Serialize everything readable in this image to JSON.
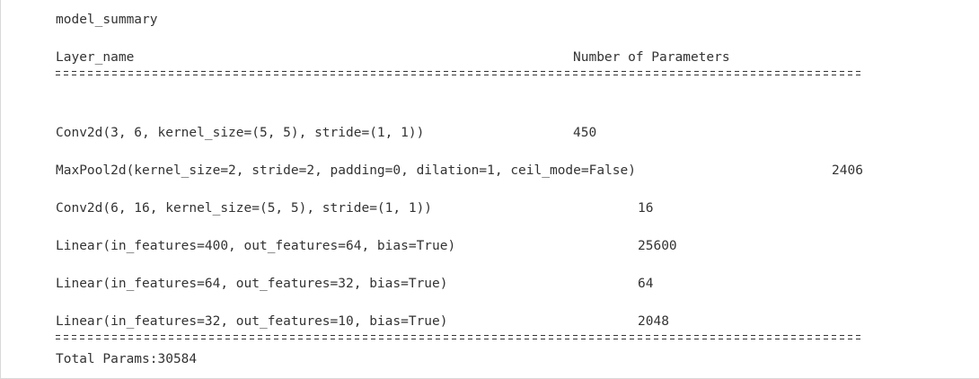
{
  "title": "model_summary",
  "header": {
    "layer_col": "Layer_name",
    "params_col": "Number of Parameters"
  },
  "layers": [
    {
      "name": "Conv2d(3, 6, kernel_size=(5, 5), stride=(1, 1))",
      "params": "450"
    },
    {
      "name": "MaxPool2d(kernel_size=2, stride=2, padding=0, dilation=1, ceil_mode=False)",
      "params": "2406"
    },
    {
      "name": "Conv2d(6, 16, kernel_size=(5, 5), stride=(1, 1))",
      "params": "16"
    },
    {
      "name": "Linear(in_features=400, out_features=64, bias=True)",
      "params": "25600"
    },
    {
      "name": "Linear(in_features=64, out_features=32, bias=True)",
      "params": "64"
    },
    {
      "name": "Linear(in_features=32, out_features=10, bias=True)",
      "params": "2048"
    }
  ],
  "total": "Total Params:30584"
}
